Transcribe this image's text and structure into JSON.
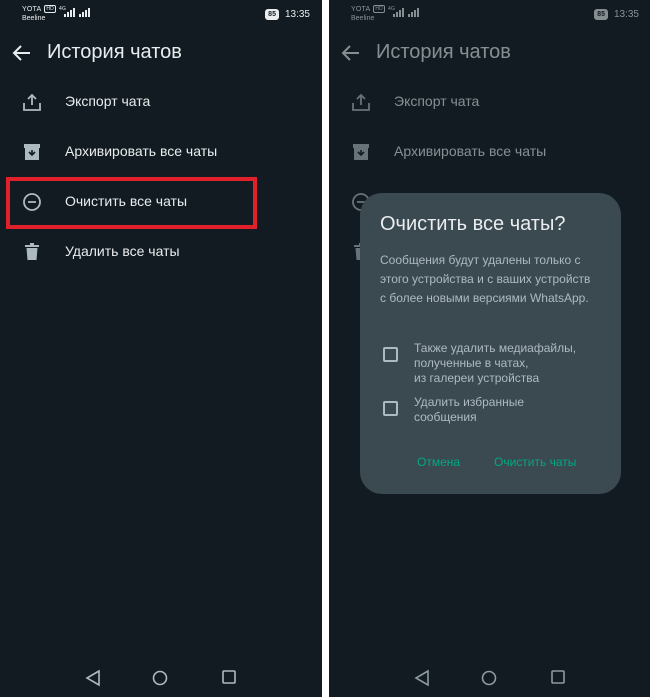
{
  "status_bar": {
    "carrier1": "YOTA",
    "carrier1_badge": "HD",
    "network": "4G",
    "carrier2": "Beeline",
    "battery": "85",
    "time": "13:35"
  },
  "header": {
    "title": "История чатов"
  },
  "menu": {
    "items": [
      {
        "label": "Экспорт чата",
        "icon": "export-icon"
      },
      {
        "label": "Архивировать все чаты",
        "icon": "archive-icon"
      },
      {
        "label": "Очистить все чаты",
        "icon": "minus-circle-icon"
      },
      {
        "label": "Удалить все чаты",
        "icon": "trash-icon"
      }
    ]
  },
  "dialog": {
    "title": "Очистить все чаты?",
    "message": "Сообщения будут удалены только с этого устройства и с ваших устройств с более новыми версиями WhatsApp.",
    "checkbox1": "Также удалить медиафайлы,\nполученные в чатах,\nиз галереи устройства",
    "checkbox2": "Удалить избранные\nсообщения",
    "cancel": "Отмена",
    "confirm": "Очистить чаты"
  },
  "colors": {
    "background": "#111b21",
    "dialog": "#3b4a50",
    "accent": "#00a884",
    "highlight": "#e0202a"
  }
}
